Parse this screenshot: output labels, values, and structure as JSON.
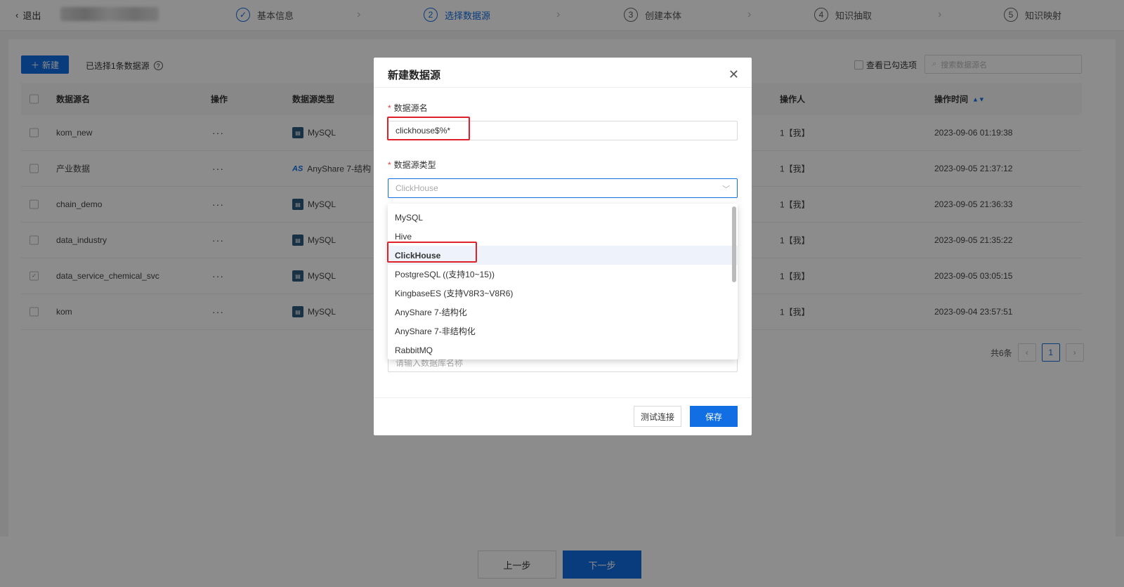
{
  "header": {
    "back_label": "退出",
    "steps": [
      {
        "num": "✓",
        "label": "基本信息"
      },
      {
        "num": "2",
        "label": "选择数据源"
      },
      {
        "num": "3",
        "label": "创建本体"
      },
      {
        "num": "4",
        "label": "知识抽取"
      },
      {
        "num": "5",
        "label": "知识映射"
      }
    ]
  },
  "toolbar": {
    "new_label": "新建",
    "selected_info": "已选择1条数据源",
    "view_checked_label": "查看已勾选项",
    "search_placeholder": "搜索数据源名"
  },
  "table": {
    "headers": {
      "name": "数据源名",
      "action": "操作",
      "type": "数据源类型",
      "operator": "操作人",
      "time": "操作时间"
    },
    "rows": [
      {
        "name": "kom_new",
        "type": "MySQL",
        "operator": "1【我】",
        "time": "2023-09-06 01:19:38",
        "checked": false
      },
      {
        "name": "产业数据",
        "type": "AnyShare 7-结构",
        "operator": "1【我】",
        "time": "2023-09-05 21:37:12",
        "checked": false
      },
      {
        "name": "chain_demo",
        "type": "MySQL",
        "operator": "1【我】",
        "time": "2023-09-05 21:36:33",
        "checked": false
      },
      {
        "name": "data_industry",
        "type": "MySQL",
        "operator": "1【我】",
        "time": "2023-09-05 21:35:22",
        "checked": false
      },
      {
        "name": "data_service_chemical_svc",
        "type": "MySQL",
        "operator": "1【我】",
        "time": "2023-09-05 03:05:15",
        "checked": true
      },
      {
        "name": "kom",
        "type": "MySQL",
        "operator": "1【我】",
        "time": "2023-09-04 23:57:51",
        "checked": false
      }
    ],
    "action_dots": "···"
  },
  "pager": {
    "total": "共6条",
    "current": "1"
  },
  "footer": {
    "prev_label": "上一步",
    "next_label": "下一步"
  },
  "modal": {
    "title": "新建数据源",
    "name_label": "数据源名",
    "name_value": "clickhouse$%*",
    "type_label": "数据源类型",
    "type_placeholder": "ClickHouse",
    "db_placeholder": "请输入数据库名称",
    "options": [
      "MySQL",
      "Hive",
      "ClickHouse",
      "PostgreSQL ((支持10~15))",
      "KingbaseES (支持V8R3~V8R6)",
      "AnyShare 7-结构化",
      "AnyShare 7-非结构化",
      "RabbitMQ"
    ],
    "selected_option": "ClickHouse",
    "test_label": "测试连接",
    "save_label": "保存"
  },
  "colors": {
    "primary": "#126ee3",
    "highlight": "#e0212a"
  }
}
